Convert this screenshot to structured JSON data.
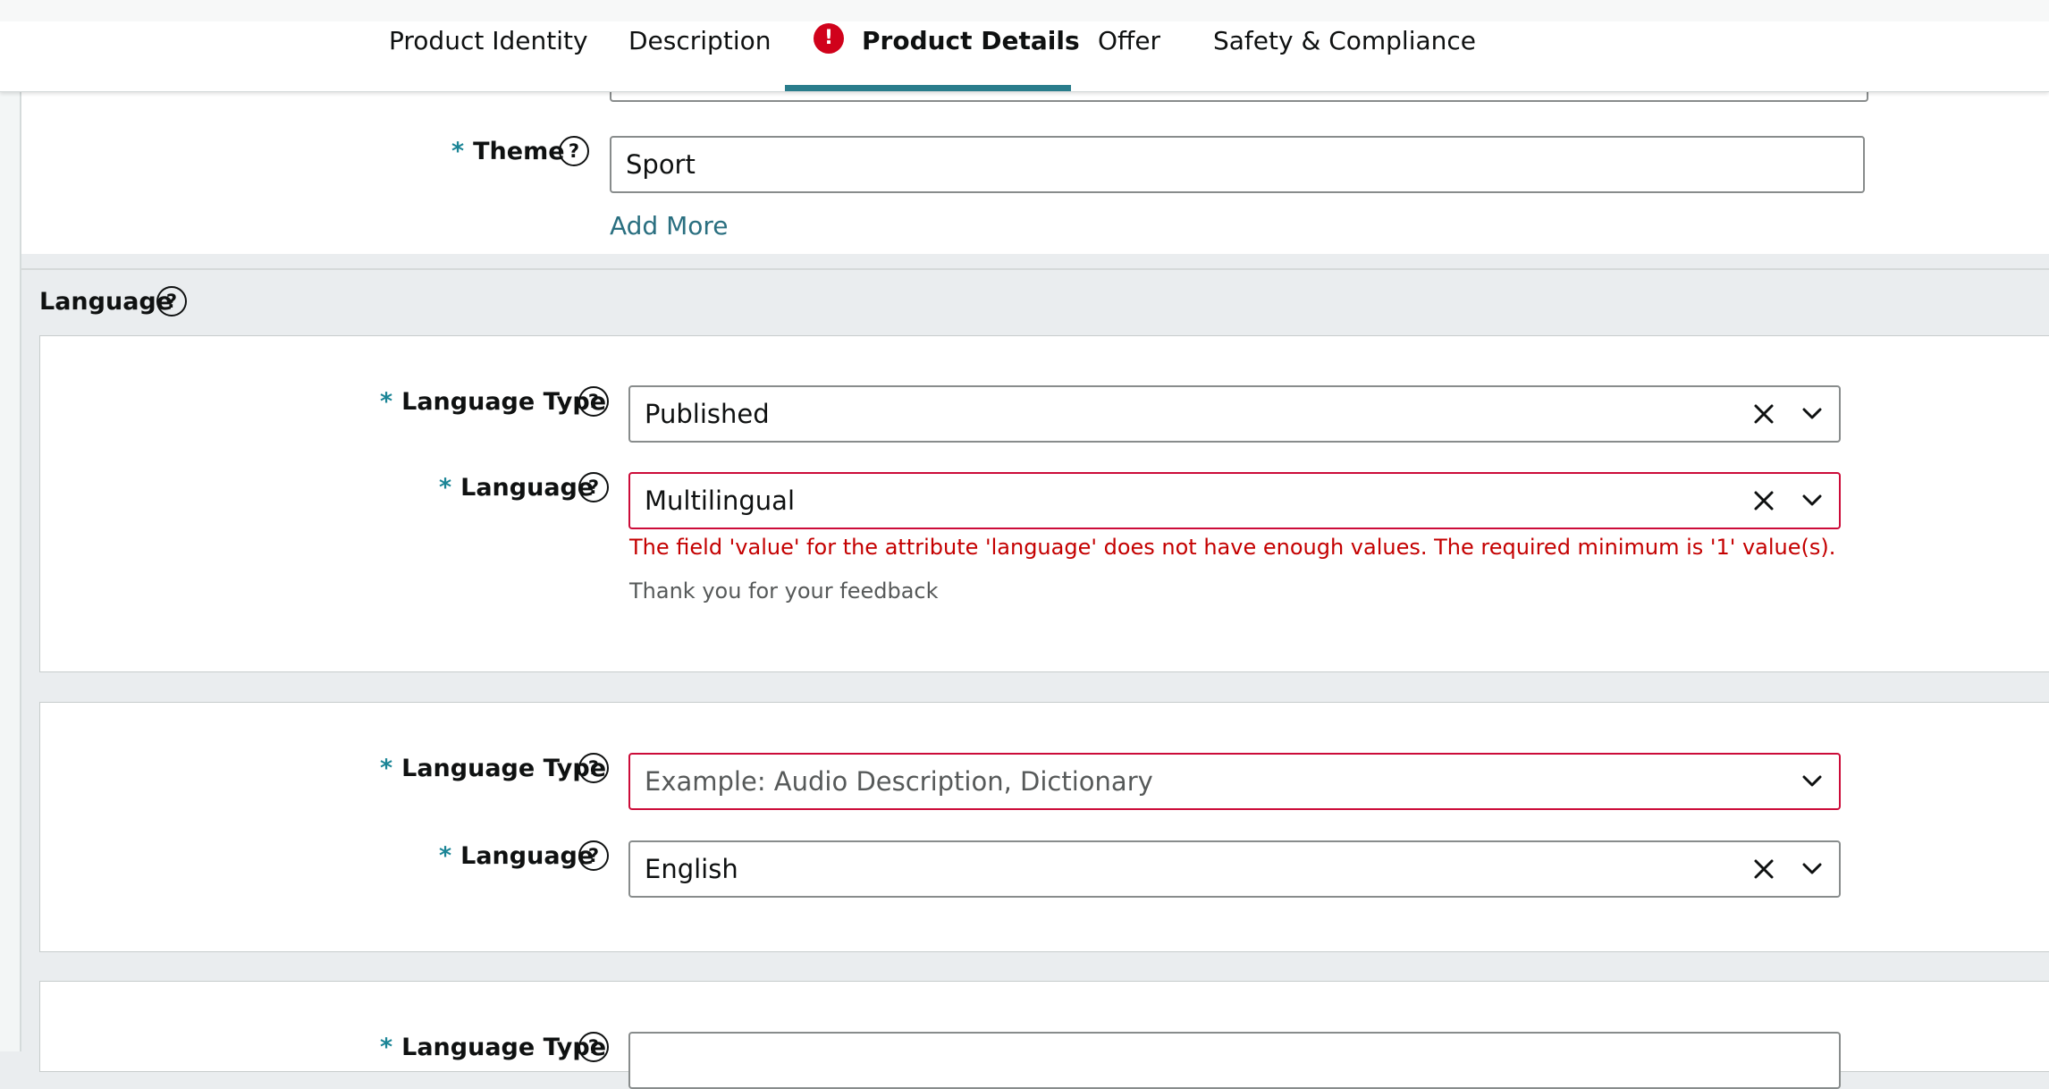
{
  "tabs": [
    {
      "label": "Product Identity"
    },
    {
      "label": "Description"
    },
    {
      "label": "Product Details",
      "active": true,
      "alert": true
    },
    {
      "label": "Offer"
    },
    {
      "label": "Safety & Compliance"
    }
  ],
  "alert_glyph": "!",
  "required_mark": "*",
  "help_glyph": "?",
  "theme": {
    "label": "Theme",
    "value": "Sport",
    "add_more": "Add More"
  },
  "language_section": {
    "title": "Language",
    "entries": [
      {
        "type_label": "Language Type",
        "type_value": "Published",
        "language_label": "Language",
        "language_value": "Multilingual",
        "error": "The field 'value' for the attribute 'language' does not have enough values. The required minimum is '1' value(s).",
        "feedback": "Thank you for your feedback"
      },
      {
        "type_label": "Language Type",
        "type_placeholder": "Example: Audio Description, Dictionary",
        "language_label": "Language",
        "language_value": "English"
      },
      {
        "type_label": "Language Type"
      }
    ]
  },
  "colors": {
    "accent_teal": "#2a7d8c",
    "required_teal": "#1b8596",
    "error_red": "#cc0c39",
    "link": "#2a6f80"
  },
  "icons": {
    "alert": "exclamation-circle-icon",
    "help": "question-circle-icon",
    "clear": "close-icon",
    "dropdown": "chevron-down-icon"
  }
}
